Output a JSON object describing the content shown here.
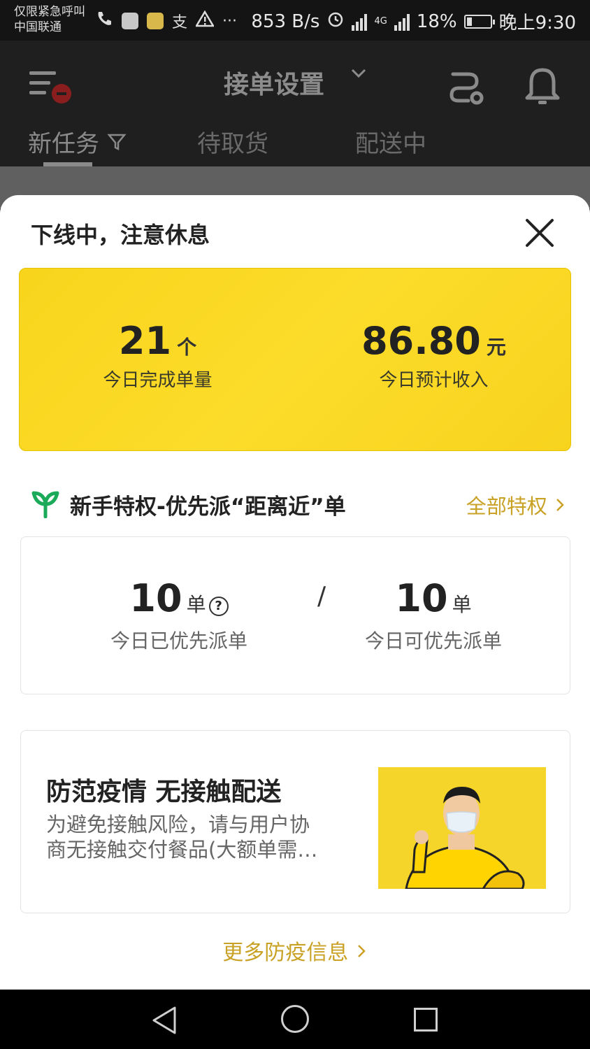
{
  "status_bar": {
    "carrier_line1": "仅限紧急呼叫",
    "carrier_line2": "中国联通",
    "alipay_glyph": "支",
    "more_glyph": "···",
    "speed": "853 B/s",
    "network_label": "4G",
    "battery": "18%",
    "time": "晚上9:30"
  },
  "header": {
    "title": "接单设置",
    "tabs": [
      "新任务",
      "待取货",
      "配送中"
    ]
  },
  "sheet": {
    "title": "下线中，注意休息",
    "stats": {
      "orders_value": "21",
      "orders_unit": "个",
      "orders_label": "今日完成单量",
      "income_value": "86.80",
      "income_unit": "元",
      "income_label": "今日预计收入"
    },
    "privilege": {
      "title": "新手特权-优先派“距离近”单",
      "link": "全部特权",
      "dispatched_value": "10",
      "dispatched_unit": "单",
      "dispatched_label": "今日已优先派单",
      "slash": "/",
      "available_value": "10",
      "available_unit": "单",
      "available_label": "今日可优先派单"
    },
    "epidemic": {
      "title": "防范疫情 无接触配送",
      "desc_line1": "为避免接触风险，请与用户协",
      "desc_line2": "商无接触交付餐品(大额单需…"
    },
    "more_link": "更多防疫信息"
  },
  "icons": {
    "menu": "menu-icon",
    "route": "route-icon",
    "bell": "bell-icon",
    "close": "close-icon",
    "sprout": "sprout-icon",
    "help": "help-icon",
    "chevron": "chevron-right-icon"
  },
  "colors": {
    "accent_yellow": "#fcdc2a",
    "link_gold": "#c9a225",
    "sprout_green": "#1aaa5a"
  }
}
